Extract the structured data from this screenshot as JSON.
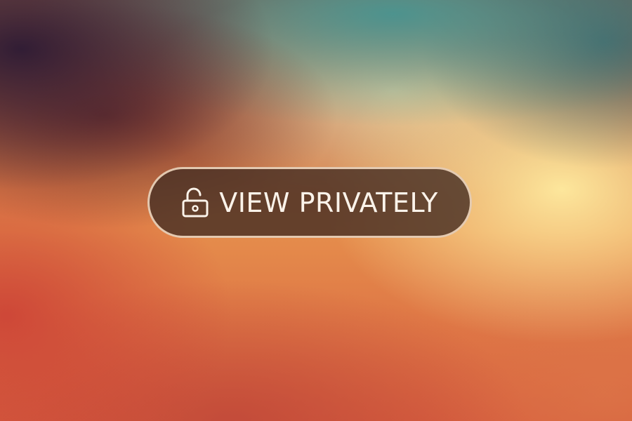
{
  "button": {
    "label": "VIEW PRIVATELY",
    "icon": "unlock-icon"
  },
  "colors": {
    "button_fill": "#4b3226",
    "button_border": "#f7e2cc",
    "button_text": "#fbf3ea"
  }
}
